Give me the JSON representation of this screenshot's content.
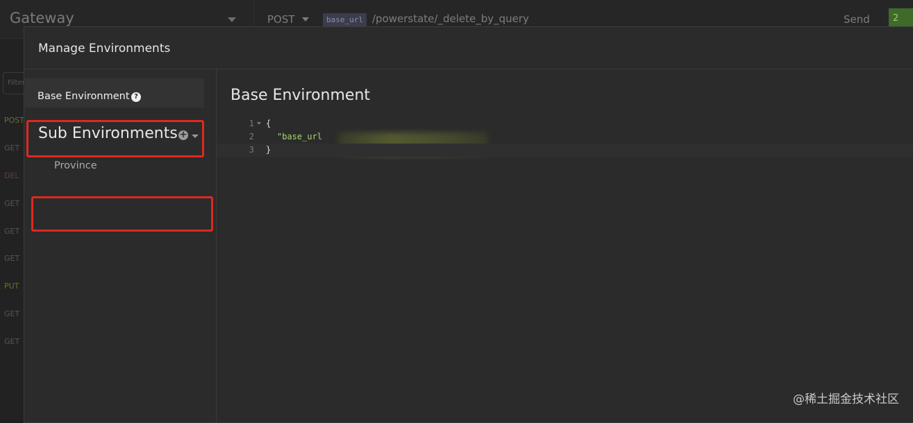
{
  "app": {
    "workspace_title": "Gateway",
    "request": {
      "method": "POST",
      "url_variable": "base_url",
      "url_path": "/powerstate/_delete_by_query",
      "send_label": "Send",
      "status_badge": "2"
    },
    "sidebar": {
      "filter_placeholder": "Filter",
      "requests": [
        "POST",
        "GET",
        "DEL",
        "GET",
        "GET",
        "GET",
        "PUT",
        "GET",
        "GET"
      ]
    }
  },
  "modal": {
    "title": "Manage Environments",
    "base_environment_label": "Base Environment",
    "help_icon_glyph": "?",
    "sub_environments_heading": "Sub Environments",
    "add_icon_glyph": "+",
    "sub_environments": [
      "Province"
    ],
    "editor": {
      "title": "Base Environment",
      "line_numbers": [
        "1",
        "2",
        "3"
      ],
      "lines": [
        "{",
        "\"base_url",
        "}"
      ]
    }
  },
  "watermark": "@稀土掘金技术社区",
  "colors": {
    "highlight_box": "#e0281f",
    "json_key": "#a8d86a",
    "background": "#2b2b2b"
  },
  "icons": [
    "chevron-down-icon",
    "help-icon",
    "plus-circle-icon",
    "fold-caret-icon"
  ]
}
